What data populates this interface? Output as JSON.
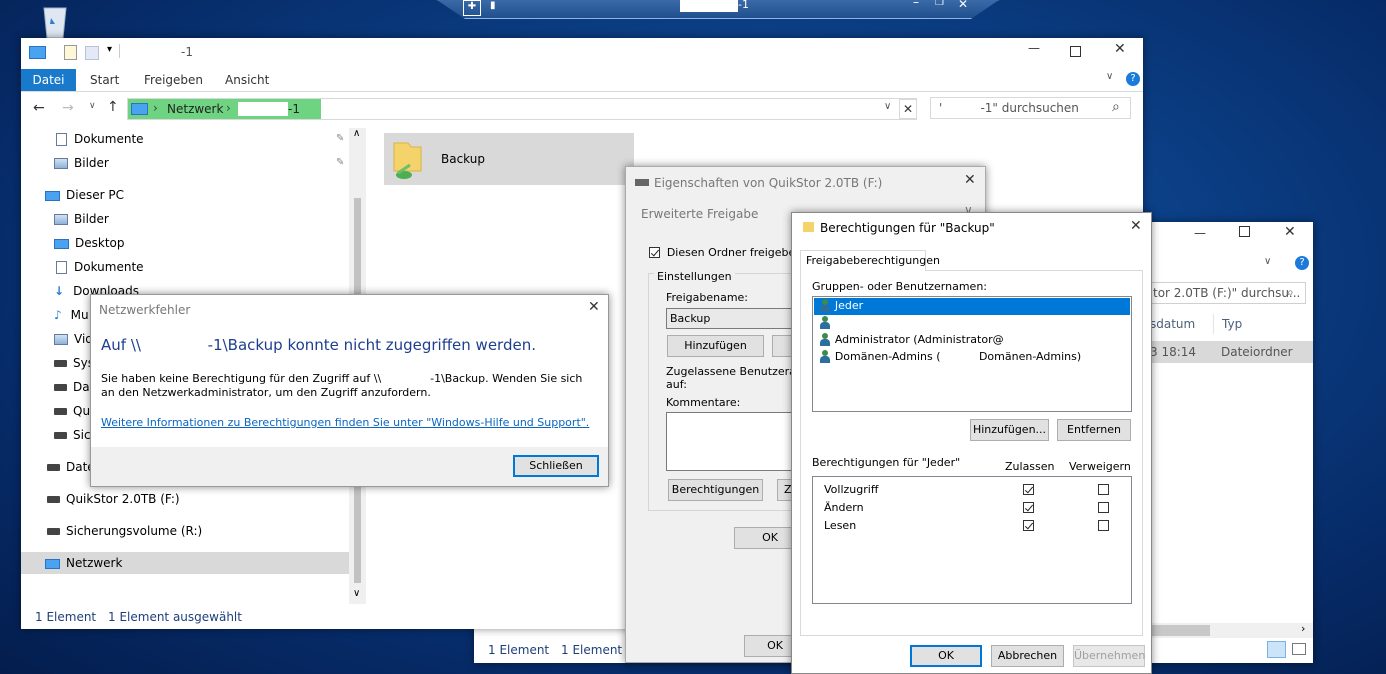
{
  "remote_bar": {
    "host_suffix": "-1"
  },
  "explorer": {
    "title": "-1",
    "ribbon_tabs": [
      "Datei",
      "Start",
      "Freigeben",
      "Ansicht"
    ],
    "address": {
      "root": "Netzwerk",
      "host_suffix": "-1"
    },
    "search_placeholder": "'          -1\" durchsuchen",
    "sidebar": [
      {
        "label": "Dokumente",
        "pinned": true
      },
      {
        "label": "Bilder",
        "pinned": true
      },
      {
        "label": "Dieser PC"
      },
      {
        "label": "Bilder"
      },
      {
        "label": "Desktop"
      },
      {
        "label": "Dokumente"
      },
      {
        "label": "Downloads"
      },
      {
        "label": "Mu"
      },
      {
        "label": "Vid"
      },
      {
        "label": "Sys"
      },
      {
        "label": "Dat"
      },
      {
        "label": "Qui"
      },
      {
        "label": "Sic"
      },
      {
        "label": "Date"
      },
      {
        "label": "QuikStor 2.0TB (F:)"
      },
      {
        "label": "Sicherungsvolume (R:)"
      },
      {
        "label": "Netzwerk"
      }
    ],
    "folder": {
      "name": "Backup"
    },
    "status": {
      "count": "1 Element",
      "selected": "1 Element ausgewählt"
    }
  },
  "net_error": {
    "title": "Netzwerkfehler",
    "heading": "Auf \\\\              -1\\Backup konnte nicht zugegriffen werden.",
    "message": "Sie haben keine Berechtigung für den Zugriff auf \\\\              -1\\Backup. Wenden Sie sich an den Netzwerkadministrator, um den Zugriff anzufordern.",
    "link": "Weitere Informationen zu Berechtigungen finden Sie unter \"Windows-Hilfe und Support\".",
    "close_button": "Schließen"
  },
  "properties": {
    "title": "Eigenschaften von QuikStor 2.0TB (F:)",
    "advanced_title": "Erweiterte Freigabe",
    "share_checkbox": "Diesen Ordner freigeben",
    "share_checked": true,
    "group_settings": "Einstellungen",
    "share_name_label": "Freigabename:",
    "share_name_value": "Backup",
    "add_button": "Hinzufügen",
    "users_label": "Zugelassene Benutzeranza",
    "users_label2": "auf:",
    "comments_label": "Kommentare:",
    "permissions_button": "Berechtigungen",
    "z_button": "Z",
    "ok_inner": "OK",
    "ok_outer": "OK"
  },
  "permissions": {
    "title": "Berechtigungen für \"Backup\"",
    "tab": "Freigabeberechtigungen",
    "groups_label": "Gruppen- oder Benutzernamen:",
    "principals": [
      "Jeder",
      "",
      "Administrator (Administrator@",
      "Domänen-Admins (           Domänen-Admins)"
    ],
    "add_button": "Hinzufügen...",
    "remove_button": "Entfernen",
    "perm_label": "Berechtigungen für \"Jeder\"",
    "allow_header": "Zulassen",
    "deny_header": "Verweigern",
    "rows": [
      {
        "name": "Vollzugriff",
        "allow": true,
        "deny": false
      },
      {
        "name": "Ändern",
        "allow": true,
        "deny": false
      },
      {
        "name": "Lesen",
        "allow": true,
        "deny": false
      }
    ],
    "ok": "OK",
    "cancel": "Abbrechen",
    "apply": "Übernehmen"
  },
  "bg_explorer": {
    "search": "tor 2.0TB (F:)\" durchsu...",
    "col_date": "sdatum",
    "col_type": "Typ",
    "row_date": "3 18:14",
    "row_type": "Dateiordner",
    "status_count": "1 Element",
    "status_selected": "1 Element au"
  }
}
